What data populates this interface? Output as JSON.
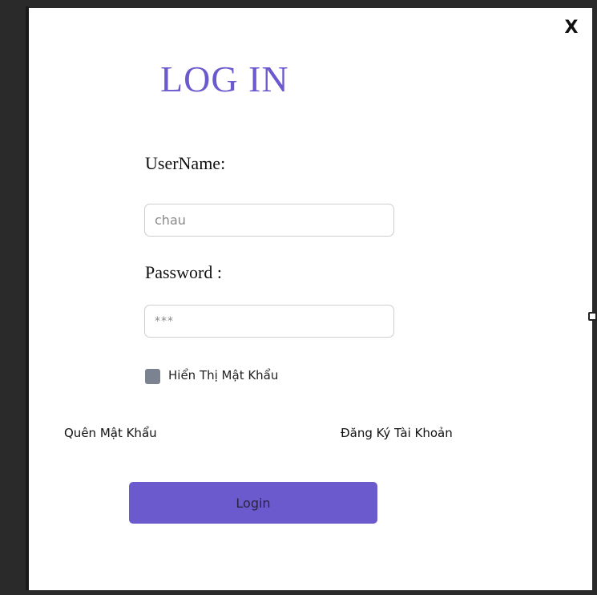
{
  "dialog": {
    "close_label": "X",
    "title": "LOG IN"
  },
  "form": {
    "username_label": "UserName:",
    "username_value": "chau",
    "password_label": "Password :",
    "password_value": "***",
    "show_password_label": "Hiển Thị Mật Khẩu",
    "show_password_checked": false
  },
  "links": {
    "forgot_password": "Quên Mật Khẩu",
    "register": "Đăng Ký Tài Khoản"
  },
  "actions": {
    "login_label": "Login"
  },
  "colors": {
    "accent": "#6a5acd",
    "checkbox": "#7b8290",
    "frame": "#2a2a2a"
  }
}
